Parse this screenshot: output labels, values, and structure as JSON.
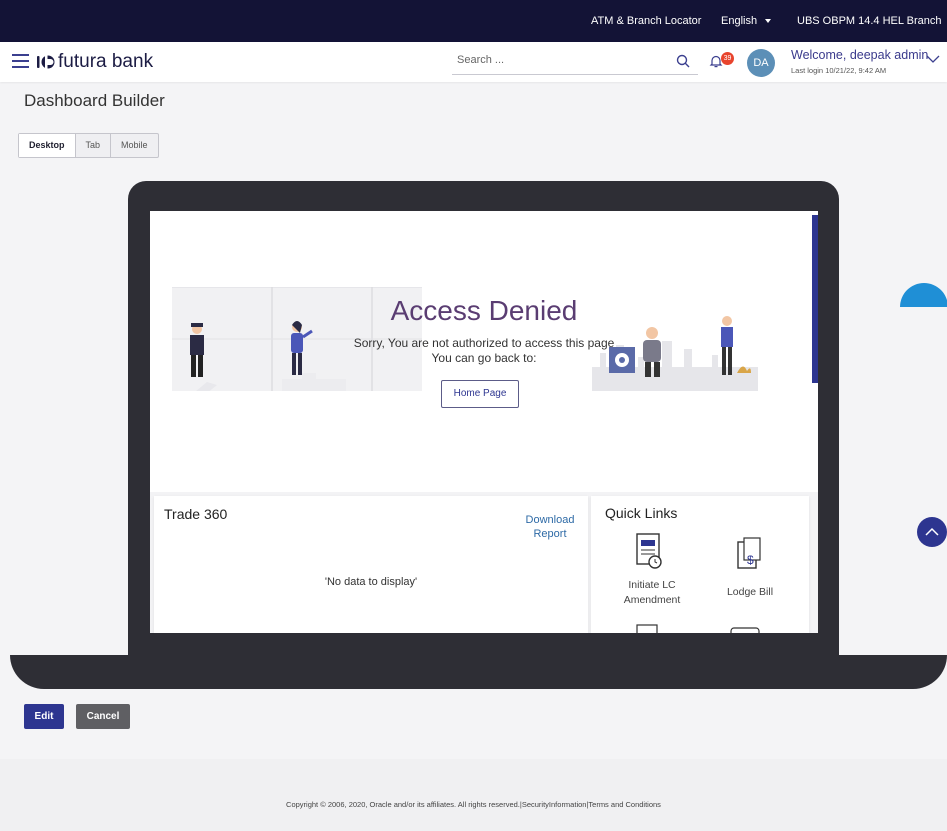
{
  "topbar": {
    "locator": "ATM & Branch Locator",
    "language": "English",
    "branch": "UBS OBPM 14.4 HEL Branch"
  },
  "header": {
    "logo_text": "futura bank",
    "search_placeholder": "Search ...",
    "notification_count": "39",
    "avatar_initials": "DA",
    "welcome": "Welcome, deepak admin",
    "last_login": "Last login 10/21/22, 9:42 AM"
  },
  "page_title": "Dashboard Builder",
  "view_tabs": [
    "Desktop",
    "Tab",
    "Mobile"
  ],
  "view_tab_selected": "Desktop",
  "access_denied": {
    "title": "Access Denied",
    "message_line1": "Sorry, You are not authorized to access this page",
    "message_line2": "You can go back to:",
    "home_button": "Home Page"
  },
  "trade360": {
    "title": "Trade 360",
    "download_report": "Download Report",
    "empty_message": "'No data to display'"
  },
  "quick_links": {
    "title": "Quick Links",
    "items": [
      {
        "label": "Initiate LC Amendment",
        "icon": "document-clock-icon"
      },
      {
        "label": "Lodge Bill",
        "icon": "bill-dollar-icon"
      }
    ]
  },
  "actions": {
    "edit": "Edit",
    "cancel": "Cancel"
  },
  "footer": {
    "copyright": "Copyright © 2006, 2020, Oracle and/or its affiliates. All rights reserved.|SecurityInformation|Terms and Conditions"
  },
  "colors": {
    "topbar_bg": "#131336",
    "primary": "#2d3590",
    "access_denied_title": "#5a3d72",
    "badge": "#e8442d",
    "cancel_button": "#5f5f63"
  }
}
